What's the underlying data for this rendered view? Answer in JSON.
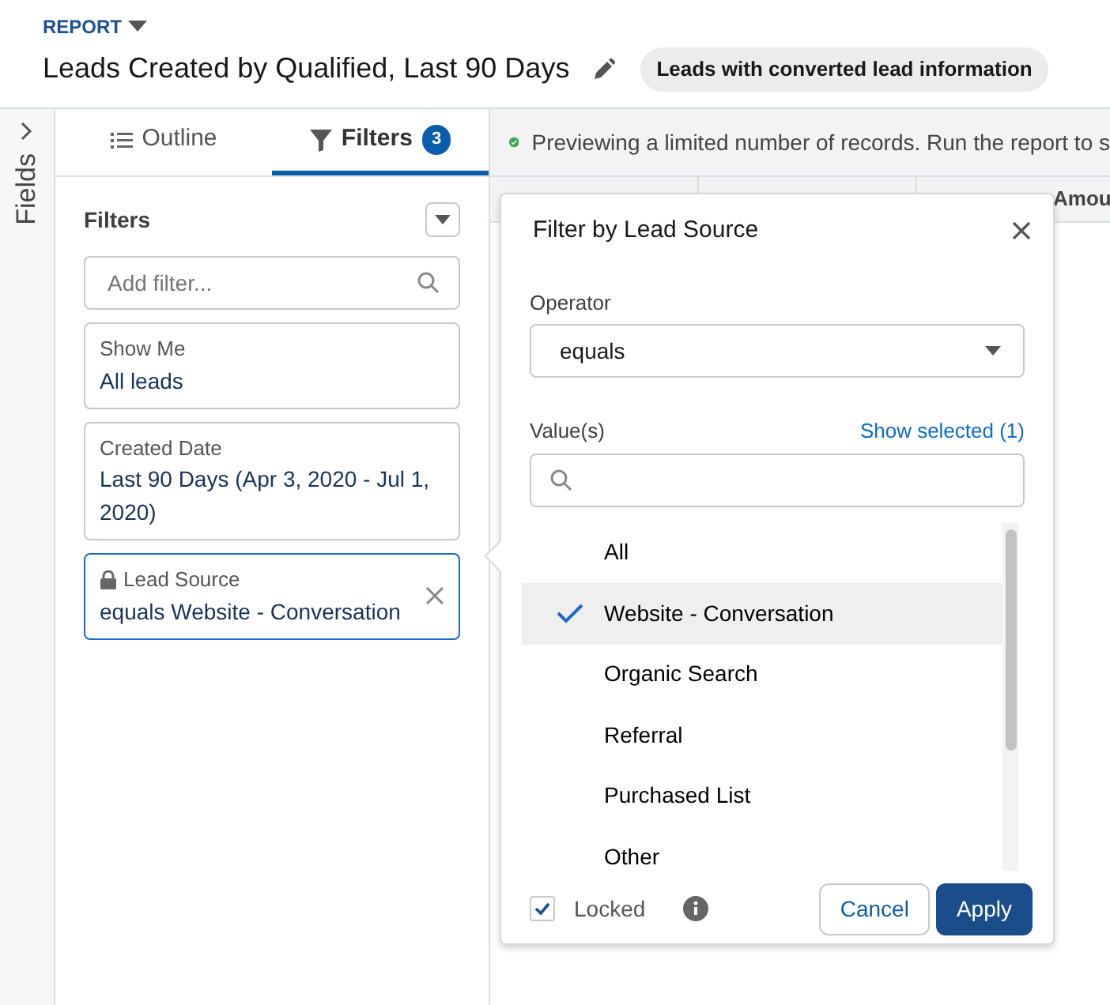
{
  "report_label": "REPORT",
  "title": "Leads Created by Qualified, Last 90 Days",
  "report_type": "Leads with converted lead information",
  "fields_tab": "Fields",
  "tabs": [
    {
      "label": "Outline",
      "selected": false
    },
    {
      "label": "Filters",
      "selected": true,
      "count": "3"
    }
  ],
  "filters_panel": {
    "heading": "Filters",
    "search": {
      "placeholder": "Add filter..."
    },
    "filters": [
      {
        "label": "Show Me",
        "value": "All leads",
        "locked": false,
        "active": false
      },
      {
        "label": "Created Date",
        "value": "Last 90 Days (Apr 3, 2020 - Jul 1, 2020)",
        "locked": false,
        "active": false
      },
      {
        "label": "Lead Source",
        "value": "equals Website - Conversation",
        "locked": true,
        "active": true
      }
    ]
  },
  "preview_message": "Previewing a limited number of records. Run the report to s",
  "columns": [
    "Amou"
  ],
  "popover": {
    "title": "Filter by Lead Source",
    "operator_label": "Operator",
    "operator": "equals",
    "values_label": "Value(s)",
    "show_selected": "Show selected (1)",
    "options": [
      {
        "label": "All",
        "selected": false
      },
      {
        "label": "Website - Conversation",
        "selected": true
      },
      {
        "label": "Organic Search",
        "selected": false
      },
      {
        "label": "Referral",
        "selected": false
      },
      {
        "label": "Purchased List",
        "selected": false
      },
      {
        "label": "Other",
        "selected": false
      }
    ],
    "locked": {
      "label": "Locked",
      "checked": true
    },
    "buttons": [
      {
        "label": "Cancel",
        "kind": "neutral"
      },
      {
        "label": "Apply",
        "kind": "brand"
      }
    ]
  }
}
